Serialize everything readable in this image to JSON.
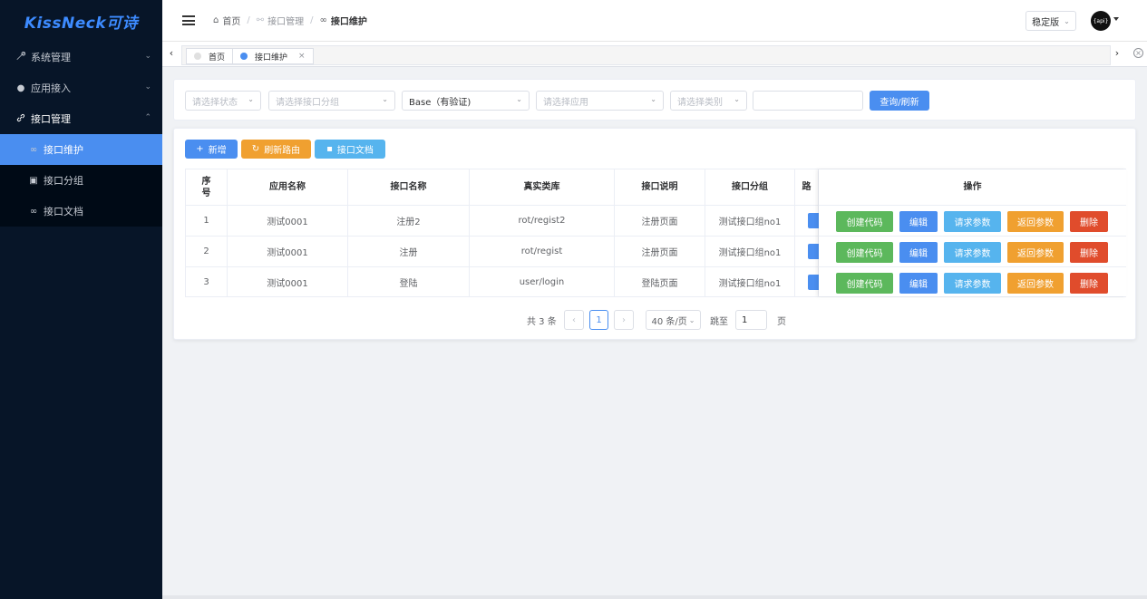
{
  "logo": "KissNeck可诗",
  "sidebar": {
    "items": [
      {
        "label": "系统管理",
        "icon": "wrench-icon"
      },
      {
        "label": "应用接入",
        "icon": "dot-icon"
      },
      {
        "label": "接口管理",
        "icon": "link-icon"
      }
    ],
    "subitems": [
      {
        "label": "接口维护",
        "icon": "infinity-icon"
      },
      {
        "label": "接口分组",
        "icon": "square-icon"
      },
      {
        "label": "接口文档",
        "icon": "infinity-icon"
      }
    ]
  },
  "header": {
    "breadcrumb": [
      "首页",
      "接口管理",
      "接口维护"
    ],
    "version": "稳定版",
    "avatar_text": "{api}"
  },
  "tabs": [
    {
      "label": "首页"
    },
    {
      "label": "接口维护",
      "close": "×"
    }
  ],
  "filter": {
    "status_placeholder": "请选择状态",
    "group_placeholder": "请选择接口分组",
    "auth_value": "Base（有验证)",
    "app_placeholder": "请选择应用",
    "type_placeholder": "请选择类别",
    "query_button": "查询/刷新"
  },
  "toolbar": {
    "add": "新增",
    "refresh_route": "刷新路由",
    "api_doc": "接口文档"
  },
  "table": {
    "headers": [
      "序\n号",
      "应用名称",
      "接口名称",
      "真实类库",
      "接口说明",
      "接口分组",
      "路",
      "操作"
    ],
    "rows": [
      [
        "1",
        "测试0001",
        "注册2",
        "rot/regist2",
        "注册页面",
        "测试接口组no1"
      ],
      [
        "2",
        "测试0001",
        "注册",
        "rot/regist",
        "注册页面",
        "测试接口组no1"
      ],
      [
        "3",
        "测试0001",
        "登陆",
        "user/login",
        "登陆页面",
        "测试接口组no1"
      ]
    ],
    "actions": [
      "创建代码",
      "编辑",
      "请求参数",
      "返回参数",
      "删除"
    ]
  },
  "pagination": {
    "total": "共 3 条",
    "current_page": "1",
    "page_size": "40 条/页",
    "goto_label": "跳至",
    "goto_value": "1",
    "page_suffix": "页"
  },
  "colors": {
    "primary": "#4a8ef0",
    "success": "#5cb85c",
    "info": "#56b4ee",
    "warning": "#f0a030",
    "danger": "#e04c2c",
    "sidebar_bg": "#071528"
  }
}
